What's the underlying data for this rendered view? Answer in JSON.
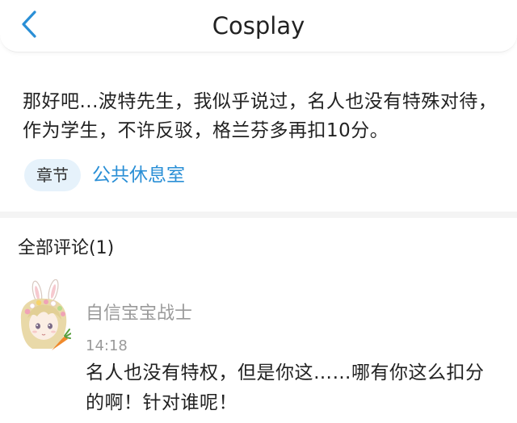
{
  "header": {
    "title": "Cosplay",
    "back_icon": "chevron-left-icon",
    "accent_color": "#2a8fd6"
  },
  "post": {
    "text": "那好吧...波特先生，我似乎说过，名人也没有特殊对待，作为学生，不许反驳，格兰芬多再扣10分。",
    "chapter_tag": "章节",
    "chapter_name": "公共休息室"
  },
  "comments": {
    "header": "全部评论(1)",
    "items": [
      {
        "avatar_icon": "bunny-girl-avatar",
        "username": "自信宝宝战士",
        "time": "14:18",
        "text": "名人也没有特权，但是你这……哪有你这么扣分的啊！针对谁呢！"
      }
    ]
  }
}
